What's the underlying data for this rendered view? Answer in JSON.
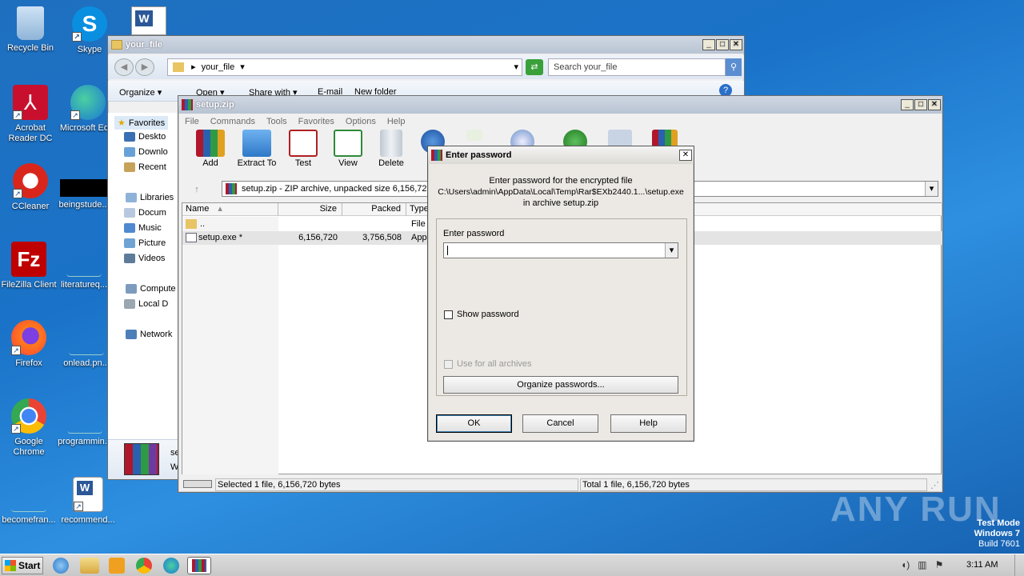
{
  "desktop": {
    "icons": [
      {
        "label": "Recycle Bin"
      },
      {
        "label": "Skype"
      },
      {
        "label": "Acrobat Reader DC"
      },
      {
        "label": "Microsoft Ed..."
      },
      {
        "label": "CCleaner"
      },
      {
        "label": "beingstude..."
      },
      {
        "label": "FileZilla Client"
      },
      {
        "label": "literatureq..."
      },
      {
        "label": "Firefox"
      },
      {
        "label": "onlead.pn..."
      },
      {
        "label": "Google Chrome"
      },
      {
        "label": "programmin..."
      },
      {
        "label": "becomefran..."
      },
      {
        "label": "recommend..."
      }
    ],
    "watermark": "ANY RUN",
    "test_mode": {
      "line1": "Test Mode",
      "line2": "Windows 7",
      "line3": "Build 7601"
    }
  },
  "explorer": {
    "title": "your_file",
    "address": "your_file",
    "search_placeholder": "Search your_file",
    "toolbar": {
      "organize": "Organize",
      "open": "Open",
      "share": "Share with",
      "email": "E-mail",
      "new_folder": "New folder"
    },
    "nav": {
      "favorites": "Favorites",
      "desktop": "Deskto",
      "downloads": "Downlo",
      "recent": "Recent",
      "libraries": "Libraries",
      "documents": "Docum",
      "music": "Music",
      "pictures": "Picture",
      "videos": "Videos",
      "computer": "Compute",
      "local_disk": "Local D",
      "network": "Network"
    },
    "preview": {
      "name": "se",
      "type": "W"
    }
  },
  "winrar": {
    "title": "setup.zip",
    "menu": [
      "File",
      "Commands",
      "Tools",
      "Favorites",
      "Options",
      "Help"
    ],
    "tools": [
      "Add",
      "Extract To",
      "Test",
      "View",
      "Delete"
    ],
    "path": "setup.zip - ZIP archive, unpacked size 6,156,720",
    "columns": {
      "name": "Name",
      "size": "Size",
      "packed": "Packed",
      "type": "Type"
    },
    "rows": [
      {
        "name": "..",
        "size": "",
        "packed": "",
        "type": "File f"
      },
      {
        "name": "setup.exe *",
        "size": "6,156,720",
        "packed": "3,756,508",
        "type": "Appl"
      }
    ],
    "status_left": "Selected 1 file, 6,156,720 bytes",
    "status_right": "Total 1 file, 6,156,720 bytes"
  },
  "dialog": {
    "title": "Enter password",
    "msg1": "Enter password for the encrypted file",
    "msg2": "C:\\Users\\admin\\AppData\\Local\\Temp\\Rar$EXb2440.1...\\setup.exe",
    "msg3": "in archive setup.zip",
    "field_label": "Enter password",
    "password_value": "",
    "show_password": "Show password",
    "use_all": "Use for all archives",
    "organize": "Organize passwords...",
    "ok": "OK",
    "cancel": "Cancel",
    "help": "Help"
  },
  "taskbar": {
    "start": "Start",
    "clock": "3:11 AM"
  },
  "colors": {
    "desktop": "#1a73c8",
    "accent": "#3c7fb1"
  }
}
